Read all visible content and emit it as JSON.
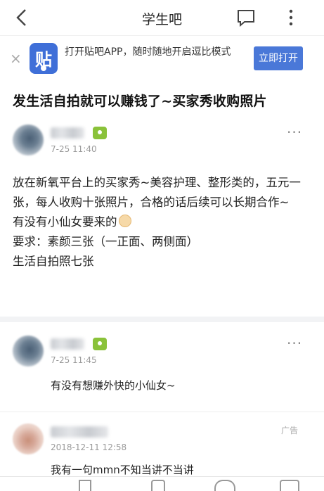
{
  "nav": {
    "title": "学生吧"
  },
  "banner": {
    "app_logo_char": "贴",
    "promo_text": "打开贴吧APP，随时随地开启逗比模式",
    "open_button": "立即打开",
    "close_symbol": "×"
  },
  "post": {
    "title": "发生活自拍就可以赚钱了~买家秀收购照片",
    "author_time": "7-25 11:40",
    "content": [
      "放在新氧平台上的买家秀~美容护理、整形类的，五元一张，每人收购十张照片，合格的话后续可以长期合作~",
      "有没有小仙女要来的",
      "要求：素颜三张（一正面、两侧面）",
      "生活自拍照七张"
    ]
  },
  "reply": {
    "time": "7-25 11:45",
    "text": "有没有想赚外快的小仙女~"
  },
  "ad": {
    "badge": "广告",
    "time": "2018-12-11 12:58",
    "text": "我有一句mmn不知当讲不当讲"
  },
  "icons": {
    "back": "chevron-left-icon",
    "comment": "comment-icon",
    "more": "more-vertical-icon",
    "dots": "···"
  }
}
